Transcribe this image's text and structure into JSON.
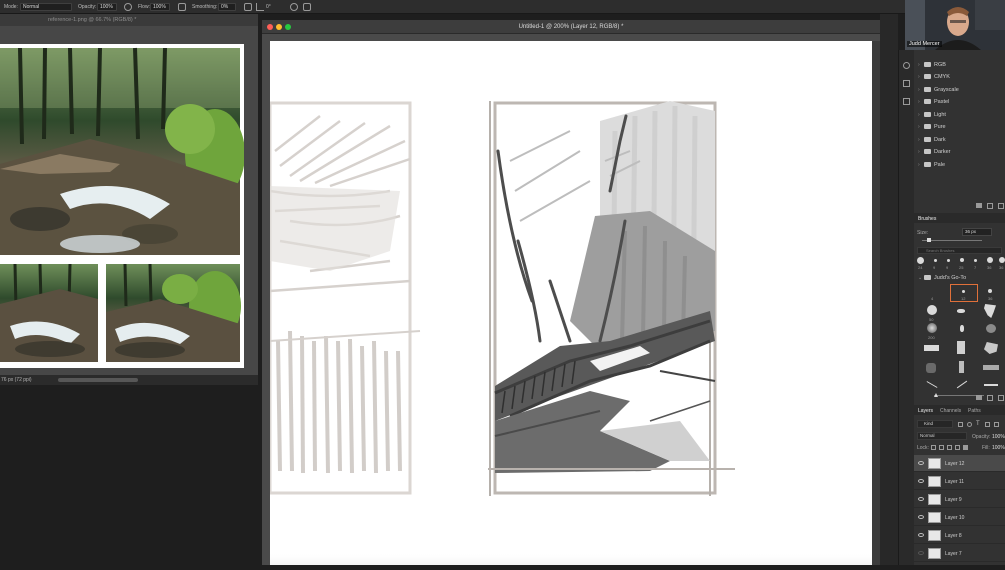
{
  "options_bar": {
    "mode_label": "Mode:",
    "mode_value": "Normal",
    "opacity_label": "Opacity:",
    "opacity_value": "100%",
    "flow_label": "Flow:",
    "flow_value": "100%",
    "smoothing_label": "Smoothing:",
    "smoothing_value": "0%",
    "angle_value": "0°"
  },
  "reference_window": {
    "tab_title": "reference-1.png @ 66.7% (RGB/8) *",
    "status_text": "76 px (72 ppi)"
  },
  "main_window": {
    "title": "Untitled-1 @ 200% (Layer 12, RGB/8) *",
    "traffic_colors": {
      "close": "#ff5f57",
      "minimize": "#febc2e",
      "zoom": "#28c840"
    }
  },
  "webcam": {
    "name": "Judd Mercer"
  },
  "swatch_groups": [
    "RGB",
    "CMYK",
    "Grayscale",
    "Pastel",
    "Light",
    "Pure",
    "Dark",
    "Darker",
    "Pale"
  ],
  "brushes_panel": {
    "title": "Brushes",
    "size_label": "Size:",
    "size_value": "36 px",
    "search_placeholder": "Search Brushes",
    "recent_sizes": [
      "24",
      "9",
      "9",
      "25",
      "7",
      "36",
      "36"
    ],
    "folder_name": "Judd's Go-To",
    "brush_sizes": [
      "4",
      "12",
      "36",
      "50",
      "200",
      "140",
      "170"
    ]
  },
  "layers_panel": {
    "tabs": [
      "Layers",
      "Channels",
      "Paths"
    ],
    "kind_label": "Kind",
    "blend_mode": "Normal",
    "opacity_label": "Opacity:",
    "opacity_value": "100%",
    "lock_label": "Lock:",
    "fill_label": "Fill:",
    "fill_value": "100%",
    "layers": [
      {
        "name": "Layer 12",
        "selected": true
      },
      {
        "name": "Layer 11",
        "selected": false
      },
      {
        "name": "Layer 9",
        "selected": false
      },
      {
        "name": "Layer 10",
        "selected": false
      },
      {
        "name": "Layer 8",
        "selected": false
      },
      {
        "name": "Layer 7",
        "selected": false
      }
    ]
  },
  "colors": {
    "accent": "#31a8ff",
    "panel": "#323232",
    "selected_brush_outline": "#e0703a"
  }
}
